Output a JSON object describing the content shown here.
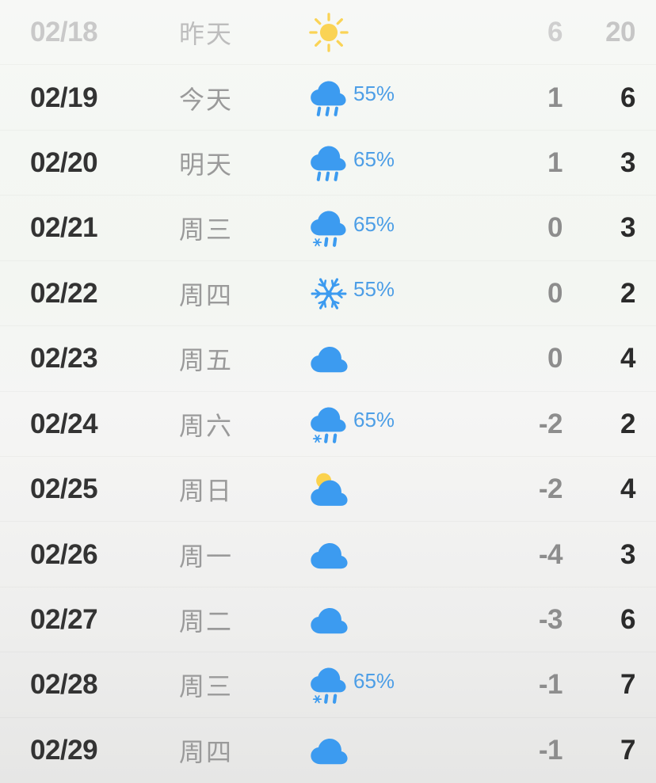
{
  "screen": {
    "title": "15-Day Weather Forecast List",
    "accent_blue": "#3C9BF0",
    "accent_yellow": "#FBD24D",
    "pop_text_color": "#4D9EE6",
    "date_color": "#333333",
    "day_color": "#9A9A9A",
    "low_temp_color": "#8D8D8D",
    "high_temp_color": "#2B2B2B",
    "past_row_color": "#C9C9C9"
  },
  "forecast": [
    {
      "date": "02/18",
      "day": "昨天",
      "icon": "sun-icon",
      "pop": "",
      "low": "6",
      "high": "20",
      "past": true
    },
    {
      "date": "02/19",
      "day": "今天",
      "icon": "rain-cloud-icon",
      "pop": "55%",
      "low": "1",
      "high": "6",
      "past": false
    },
    {
      "date": "02/20",
      "day": "明天",
      "icon": "rain-cloud-icon",
      "pop": "65%",
      "low": "1",
      "high": "3",
      "past": false
    },
    {
      "date": "02/21",
      "day": "周三",
      "icon": "sleet-cloud-icon",
      "pop": "65%",
      "low": "0",
      "high": "3",
      "past": false
    },
    {
      "date": "02/22",
      "day": "周四",
      "icon": "snowflake-icon",
      "pop": "55%",
      "low": "0",
      "high": "2",
      "past": false
    },
    {
      "date": "02/23",
      "day": "周五",
      "icon": "cloud-icon",
      "pop": "",
      "low": "0",
      "high": "4",
      "past": false
    },
    {
      "date": "02/24",
      "day": "周六",
      "icon": "sleet-cloud-icon",
      "pop": "65%",
      "low": "-2",
      "high": "2",
      "past": false
    },
    {
      "date": "02/25",
      "day": "周日",
      "icon": "partly-cloudy-icon",
      "pop": "",
      "low": "-2",
      "high": "4",
      "past": false
    },
    {
      "date": "02/26",
      "day": "周一",
      "icon": "cloud-icon",
      "pop": "",
      "low": "-4",
      "high": "3",
      "past": false
    },
    {
      "date": "02/27",
      "day": "周二",
      "icon": "cloud-icon",
      "pop": "",
      "low": "-3",
      "high": "6",
      "past": false
    },
    {
      "date": "02/28",
      "day": "周三",
      "icon": "sleet-cloud-icon",
      "pop": "65%",
      "low": "-1",
      "high": "7",
      "past": false
    },
    {
      "date": "02/29",
      "day": "周四",
      "icon": "cloud-icon",
      "pop": "",
      "low": "-1",
      "high": "7",
      "past": false
    }
  ]
}
